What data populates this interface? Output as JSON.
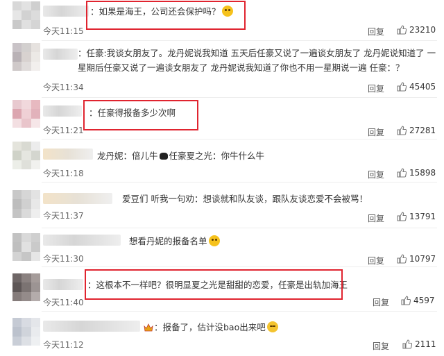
{
  "comments": [
    {
      "text": "：如果是海王，公司还会保护吗？",
      "emoji": "doge-emoji",
      "time": "今天11:15",
      "reply": "回复",
      "likes": "23210",
      "highlighted": true
    },
    {
      "text": "：任豪:我谈女朋友了。龙丹妮说我知道 五天后任豪又说了一遍谈女朋友了 龙丹妮说知道了 一星期后任豪又说了一遍谈女朋友了 龙丹妮说我知道了你也不用一星期说一遍 任豪：？",
      "time": "今天11:34",
      "reply": "回复",
      "likes": "45405",
      "highlighted": false
    },
    {
      "text": "：任豪得报备多少次啊",
      "time": "今天11:21",
      "reply": "回复",
      "likes": "27281",
      "highlighted": true
    },
    {
      "text": "龙丹妮：倍儿牛",
      "text_b": "任豪夏之光：你牛什么牛",
      "emoji": "cow-emoji",
      "time": "今天11:18",
      "reply": "回复",
      "likes": "15898",
      "highlighted": false
    },
    {
      "text": "爱豆们 听我一句劝：想谈就和队友谈，跟队友谈恋爱不会被骂！",
      "time": "今天11:37",
      "reply": "回复",
      "likes": "13791",
      "highlighted": false
    },
    {
      "text": "想看丹妮的报备名单",
      "emoji": "doge-emoji",
      "time": "今天11:30",
      "reply": "回复",
      "likes": "10797",
      "highlighted": false
    },
    {
      "text": "：这根本不一样吧？很明显夏之光是甜甜的恋爱，任豪是出轨加海王",
      "time": "今天11:40",
      "reply": "回复",
      "likes": "4597",
      "highlighted": true
    },
    {
      "text": "：报备了，估计没bao出来吧",
      "emoji": "laugh-emoji",
      "time": "今天11:12",
      "reply": "回复",
      "likes": "2111",
      "highlighted": false
    }
  ],
  "colors": {
    "highlight_border": "#e0242f",
    "emoji_yellow": "#f6c21c",
    "divider": "#eeeeee"
  }
}
